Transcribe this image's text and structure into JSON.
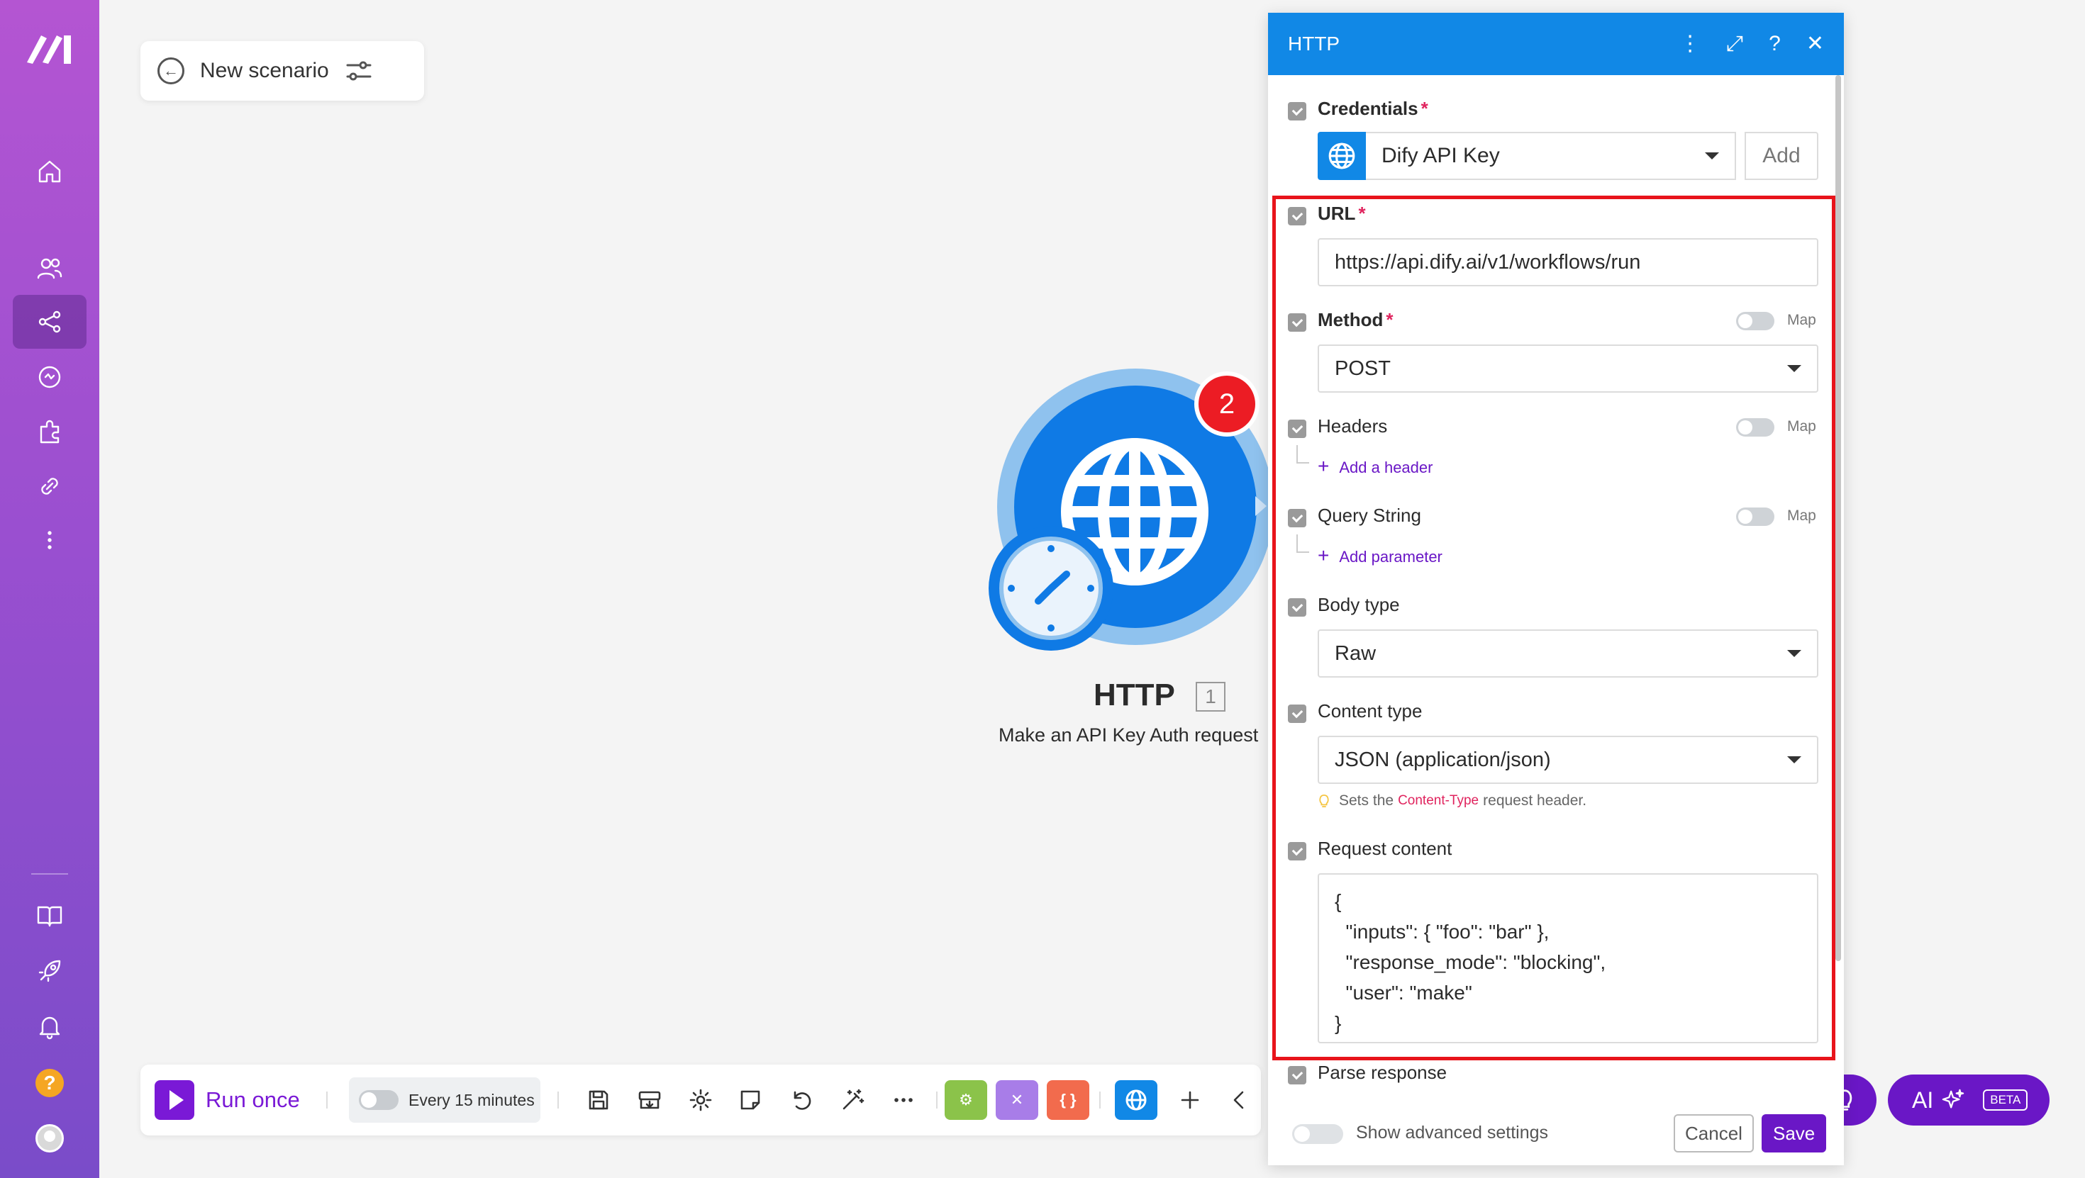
{
  "scenario": {
    "title": "New scenario"
  },
  "module": {
    "name": "HTTP",
    "index": "1",
    "description": "Make an API Key Auth request",
    "badge_count": "2",
    "color": "#0f7ae5"
  },
  "toolbar": {
    "run_label": "Run once",
    "schedule_label": "Every 15 minutes"
  },
  "ai_button": {
    "label": "AI",
    "badge": "BETA"
  },
  "dialog": {
    "title": "HTTP",
    "header_icons": [
      "more-vertical-icon",
      "expand-icon",
      "help-icon",
      "close-icon"
    ],
    "credentials": {
      "label": "Credentials",
      "value": "Dify API Key",
      "add_label": "Add"
    },
    "url": {
      "label": "URL",
      "value": "https://api.dify.ai/v1/workflows/run"
    },
    "method": {
      "label": "Method",
      "value": "POST",
      "map_label": "Map"
    },
    "headers": {
      "label": "Headers",
      "map_label": "Map",
      "add_label": "Add a header"
    },
    "query_string": {
      "label": "Query String",
      "map_label": "Map",
      "add_label": "Add parameter"
    },
    "body_type": {
      "label": "Body type",
      "value": "Raw"
    },
    "content_type": {
      "label": "Content type",
      "value": "JSON (application/json)",
      "hint_prefix": "Sets the",
      "hint_code": "Content-Type",
      "hint_suffix": "request header."
    },
    "request_content": {
      "label": "Request content",
      "value": "{\n  \"inputs\": { \"foo\": \"bar\" },\n  \"response_mode\": \"blocking\",\n  \"user\": \"make\"\n}"
    },
    "parse_response": {
      "label": "Parse response"
    },
    "footer": {
      "advanced_label": "Show advanced settings",
      "cancel_label": "Cancel",
      "save_label": "Save"
    }
  },
  "colors": {
    "accent": "#6a17c6",
    "header": "#1188e6",
    "highlight": "#e8141b"
  }
}
